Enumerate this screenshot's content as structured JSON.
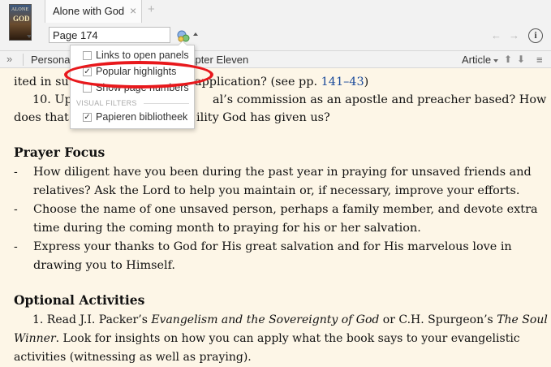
{
  "tab": {
    "title": "Alone with God",
    "close": "×",
    "add": "+"
  },
  "book_cover": {
    "line1": "ALONE",
    "line2": "GOD"
  },
  "navigation": {
    "page_value": "Page 174",
    "back": "←",
    "forward": "→",
    "info": "i"
  },
  "toolbar": {
    "collapse": "»",
    "personal": "Personal",
    "chapter": "hapter Eleven",
    "article": "Article",
    "up": "⬆",
    "down": "⬇",
    "menu": "≡"
  },
  "dropdown": {
    "items": [
      {
        "label": "Links to open panels",
        "checked": false,
        "check": ""
      },
      {
        "label": "Popular highlights",
        "checked": true,
        "check": "✓"
      },
      {
        "label": "Show page numbers",
        "checked": false,
        "check": ""
      }
    ],
    "group_label": "VISUAL FILTERS",
    "filters": [
      {
        "label": "Papieren bibliotheek",
        "checked": true,
        "check": "✓"
      }
    ]
  },
  "content": {
    "p1_line1_start": "ited in su",
    "p1_line1_mid": "application? (see pp. ",
    "p1_ref": "141–43",
    "p1_line1_end": ")",
    "p2_line1_start": "10. Upo",
    "p2_line1_end": "al’s commission as an apostle and preacher based? How",
    "p2_line2_start": "does that r",
    "p2_line2_end": "ility God has given us?",
    "prayer_heading": "Prayer Focus",
    "bullet_glyph": "-",
    "b1_l1": "How diligent have you been during the past year in praying for unsaved friends and",
    "b1_l2": "relatives? Ask the Lord to help you maintain or, if necessary, improve your efforts.",
    "b2_l1": "Choose the name of one unsaved person, perhaps a family member, and devote extra",
    "b2_l2": "time during the coming month to praying for his or her salvation.",
    "b3_l1": "Express your thanks to God for His great salvation and for His marvelous love in",
    "b3_l2": "drawing you to Himself.",
    "optional_heading": "Optional Activities",
    "o1_a": "1. Read J.I. Packer’s ",
    "o1_italic1": "Evangelism and the Sovereignty of God",
    "o1_b": " or C.H. Spurgeon’s ",
    "o1_italic2": "The Soul",
    "o2_italic": "Winner",
    "o2_rest": ". Look for insights on how you can apply what the book says to your evangelistic",
    "o3": "activities (witnessing as well as praying)."
  }
}
